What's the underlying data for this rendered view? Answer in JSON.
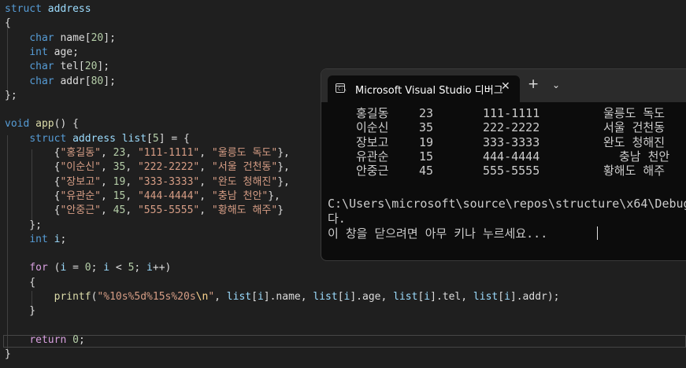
{
  "editor": {
    "lines": [
      [
        [
          "kw",
          "struct"
        ],
        [
          "plain",
          " "
        ],
        [
          "var",
          "address"
        ]
      ],
      [
        [
          "plain",
          "{"
        ]
      ],
      [
        [
          "plain",
          "    "
        ],
        [
          "kw",
          "char"
        ],
        [
          "plain",
          " name["
        ],
        [
          "num",
          "20"
        ],
        [
          "plain",
          "];"
        ]
      ],
      [
        [
          "plain",
          "    "
        ],
        [
          "kw",
          "int"
        ],
        [
          "plain",
          " age;"
        ]
      ],
      [
        [
          "plain",
          "    "
        ],
        [
          "kw",
          "char"
        ],
        [
          "plain",
          " tel["
        ],
        [
          "num",
          "20"
        ],
        [
          "plain",
          "];"
        ]
      ],
      [
        [
          "plain",
          "    "
        ],
        [
          "kw",
          "char"
        ],
        [
          "plain",
          " addr["
        ],
        [
          "num",
          "80"
        ],
        [
          "plain",
          "];"
        ]
      ],
      [
        [
          "plain",
          "};"
        ]
      ],
      [],
      [
        [
          "kw",
          "void"
        ],
        [
          "plain",
          " "
        ],
        [
          "fn",
          "app"
        ],
        [
          "plain",
          "() {"
        ]
      ],
      [
        [
          "plain",
          "    "
        ],
        [
          "kw",
          "struct"
        ],
        [
          "plain",
          " "
        ],
        [
          "var",
          "address"
        ],
        [
          "plain",
          " "
        ],
        [
          "var",
          "list"
        ],
        [
          "plain",
          "["
        ],
        [
          "num",
          "5"
        ],
        [
          "plain",
          "] = {"
        ]
      ],
      [
        [
          "plain",
          "        {"
        ],
        [
          "str",
          "\"홍길동\""
        ],
        [
          "plain",
          ", "
        ],
        [
          "num",
          "23"
        ],
        [
          "plain",
          ", "
        ],
        [
          "str",
          "\"111-1111\""
        ],
        [
          "plain",
          ", "
        ],
        [
          "str",
          "\"울릉도 독도\""
        ],
        [
          "plain",
          "},"
        ]
      ],
      [
        [
          "plain",
          "        {"
        ],
        [
          "str",
          "\"이순신\""
        ],
        [
          "plain",
          ", "
        ],
        [
          "num",
          "35"
        ],
        [
          "plain",
          ", "
        ],
        [
          "str",
          "\"222-2222\""
        ],
        [
          "plain",
          ", "
        ],
        [
          "str",
          "\"서울 건천동\""
        ],
        [
          "plain",
          "},"
        ]
      ],
      [
        [
          "plain",
          "        {"
        ],
        [
          "str",
          "\"장보고\""
        ],
        [
          "plain",
          ", "
        ],
        [
          "num",
          "19"
        ],
        [
          "plain",
          ", "
        ],
        [
          "str",
          "\"333-3333\""
        ],
        [
          "plain",
          ", "
        ],
        [
          "str",
          "\"완도 청해진\""
        ],
        [
          "plain",
          "},"
        ]
      ],
      [
        [
          "plain",
          "        {"
        ],
        [
          "str",
          "\"유관순\""
        ],
        [
          "plain",
          ", "
        ],
        [
          "num",
          "15"
        ],
        [
          "plain",
          ", "
        ],
        [
          "str",
          "\"444-4444\""
        ],
        [
          "plain",
          ", "
        ],
        [
          "str",
          "\"충남 천안\""
        ],
        [
          "plain",
          "},"
        ]
      ],
      [
        [
          "plain",
          "        {"
        ],
        [
          "str",
          "\"안중근\""
        ],
        [
          "plain",
          ", "
        ],
        [
          "num",
          "45"
        ],
        [
          "plain",
          ", "
        ],
        [
          "str",
          "\"555-5555\""
        ],
        [
          "plain",
          ", "
        ],
        [
          "str",
          "\"황해도 해주\""
        ],
        [
          "plain",
          "}"
        ]
      ],
      [
        [
          "plain",
          "    };"
        ]
      ],
      [
        [
          "plain",
          "    "
        ],
        [
          "kw",
          "int"
        ],
        [
          "plain",
          " "
        ],
        [
          "var",
          "i"
        ],
        [
          "plain",
          ";"
        ]
      ],
      [],
      [
        [
          "plain",
          "    "
        ],
        [
          "flow",
          "for"
        ],
        [
          "plain",
          " ("
        ],
        [
          "var",
          "i"
        ],
        [
          "plain",
          " = "
        ],
        [
          "num",
          "0"
        ],
        [
          "plain",
          "; "
        ],
        [
          "var",
          "i"
        ],
        [
          "plain",
          " < "
        ],
        [
          "num",
          "5"
        ],
        [
          "plain",
          "; "
        ],
        [
          "var",
          "i"
        ],
        [
          "plain",
          "++)"
        ]
      ],
      [
        [
          "plain",
          "    {"
        ]
      ],
      [
        [
          "plain",
          "        "
        ],
        [
          "fn",
          "printf"
        ],
        [
          "plain",
          "("
        ],
        [
          "str",
          "\"%10s%5d%15s%20s"
        ],
        [
          "esc",
          "\\n"
        ],
        [
          "str",
          "\""
        ],
        [
          "plain",
          ", "
        ],
        [
          "var",
          "list"
        ],
        [
          "plain",
          "["
        ],
        [
          "var",
          "i"
        ],
        [
          "plain",
          "].name, "
        ],
        [
          "var",
          "list"
        ],
        [
          "plain",
          "["
        ],
        [
          "var",
          "i"
        ],
        [
          "plain",
          "].age, "
        ],
        [
          "var",
          "list"
        ],
        [
          "plain",
          "["
        ],
        [
          "var",
          "i"
        ],
        [
          "plain",
          "].tel, "
        ],
        [
          "var",
          "list"
        ],
        [
          "plain",
          "["
        ],
        [
          "var",
          "i"
        ],
        [
          "plain",
          "].addr);"
        ]
      ],
      [
        [
          "plain",
          "    }"
        ]
      ],
      [],
      [
        [
          "plain",
          "    "
        ],
        [
          "flow",
          "return"
        ],
        [
          "plain",
          " "
        ],
        [
          "num",
          "0"
        ],
        [
          "plain",
          ";"
        ]
      ],
      [
        [
          "plain",
          "}"
        ]
      ]
    ]
  },
  "console": {
    "tab_title": "Microsoft Visual Studio 디버그",
    "close_glyph": "✕",
    "new_tab_glyph": "+",
    "dropdown_glyph": "⌄",
    "icon_text": "C:\\",
    "rows": [
      {
        "name": "홍길동",
        "age": "23",
        "tel": "111-1111",
        "addr": "울릉도 독도"
      },
      {
        "name": "이순신",
        "age": "35",
        "tel": "222-2222",
        "addr": "서울 건천동"
      },
      {
        "name": "장보고",
        "age": "19",
        "tel": "333-3333",
        "addr": "완도 청해진"
      },
      {
        "name": "유관순",
        "age": "15",
        "tel": "444-4444",
        "addr": "충남 천안"
      },
      {
        "name": "안중근",
        "age": "45",
        "tel": "555-5555",
        "addr": "황해도 해주"
      }
    ],
    "path_line": "C:\\Users\\microsoft\\source\\repos\\structure\\x64\\Debug",
    "wrap_line": "다.",
    "prompt_line": "이 창을 닫으려면 아무 키나 누르세요..."
  }
}
